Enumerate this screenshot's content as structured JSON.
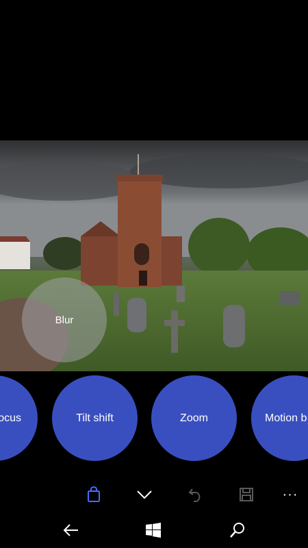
{
  "overlay": {
    "label": "Blur"
  },
  "effects": [
    {
      "label": "Focus",
      "visible_label": "ocus"
    },
    {
      "label": "Tilt shift"
    },
    {
      "label": "Zoom"
    },
    {
      "label": "Motion blur",
      "visible_label": "Motion b"
    }
  ],
  "appbar": {
    "icons": [
      "shopping-bag-icon",
      "chevron-down-icon",
      "undo-icon",
      "save-icon",
      "more-icon"
    ],
    "more_glyph": "···"
  },
  "navbar": {
    "icons": [
      "back-icon",
      "windows-icon",
      "search-icon"
    ]
  },
  "colors": {
    "accent": "#3a4fbf",
    "active_icon": "#4a6cff",
    "inactive_icon": "#5a5a5a",
    "icon": "#ffffff",
    "background": "#000000"
  }
}
